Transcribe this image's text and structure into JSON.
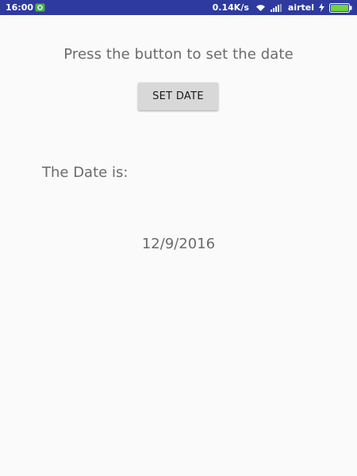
{
  "status_bar": {
    "time": "16:00",
    "network_speed": "0.14K/s",
    "carrier": "airtel",
    "background_color": "#2e3a9e",
    "icons": [
      "notification-icon",
      "wifi-icon",
      "signal-icon",
      "charging-icon",
      "battery-icon"
    ]
  },
  "main": {
    "prompt": "Press the button to set the date",
    "set_date_button_label": "SET DATE",
    "date_label": "The Date is:",
    "date_value": "12/9/2016"
  }
}
